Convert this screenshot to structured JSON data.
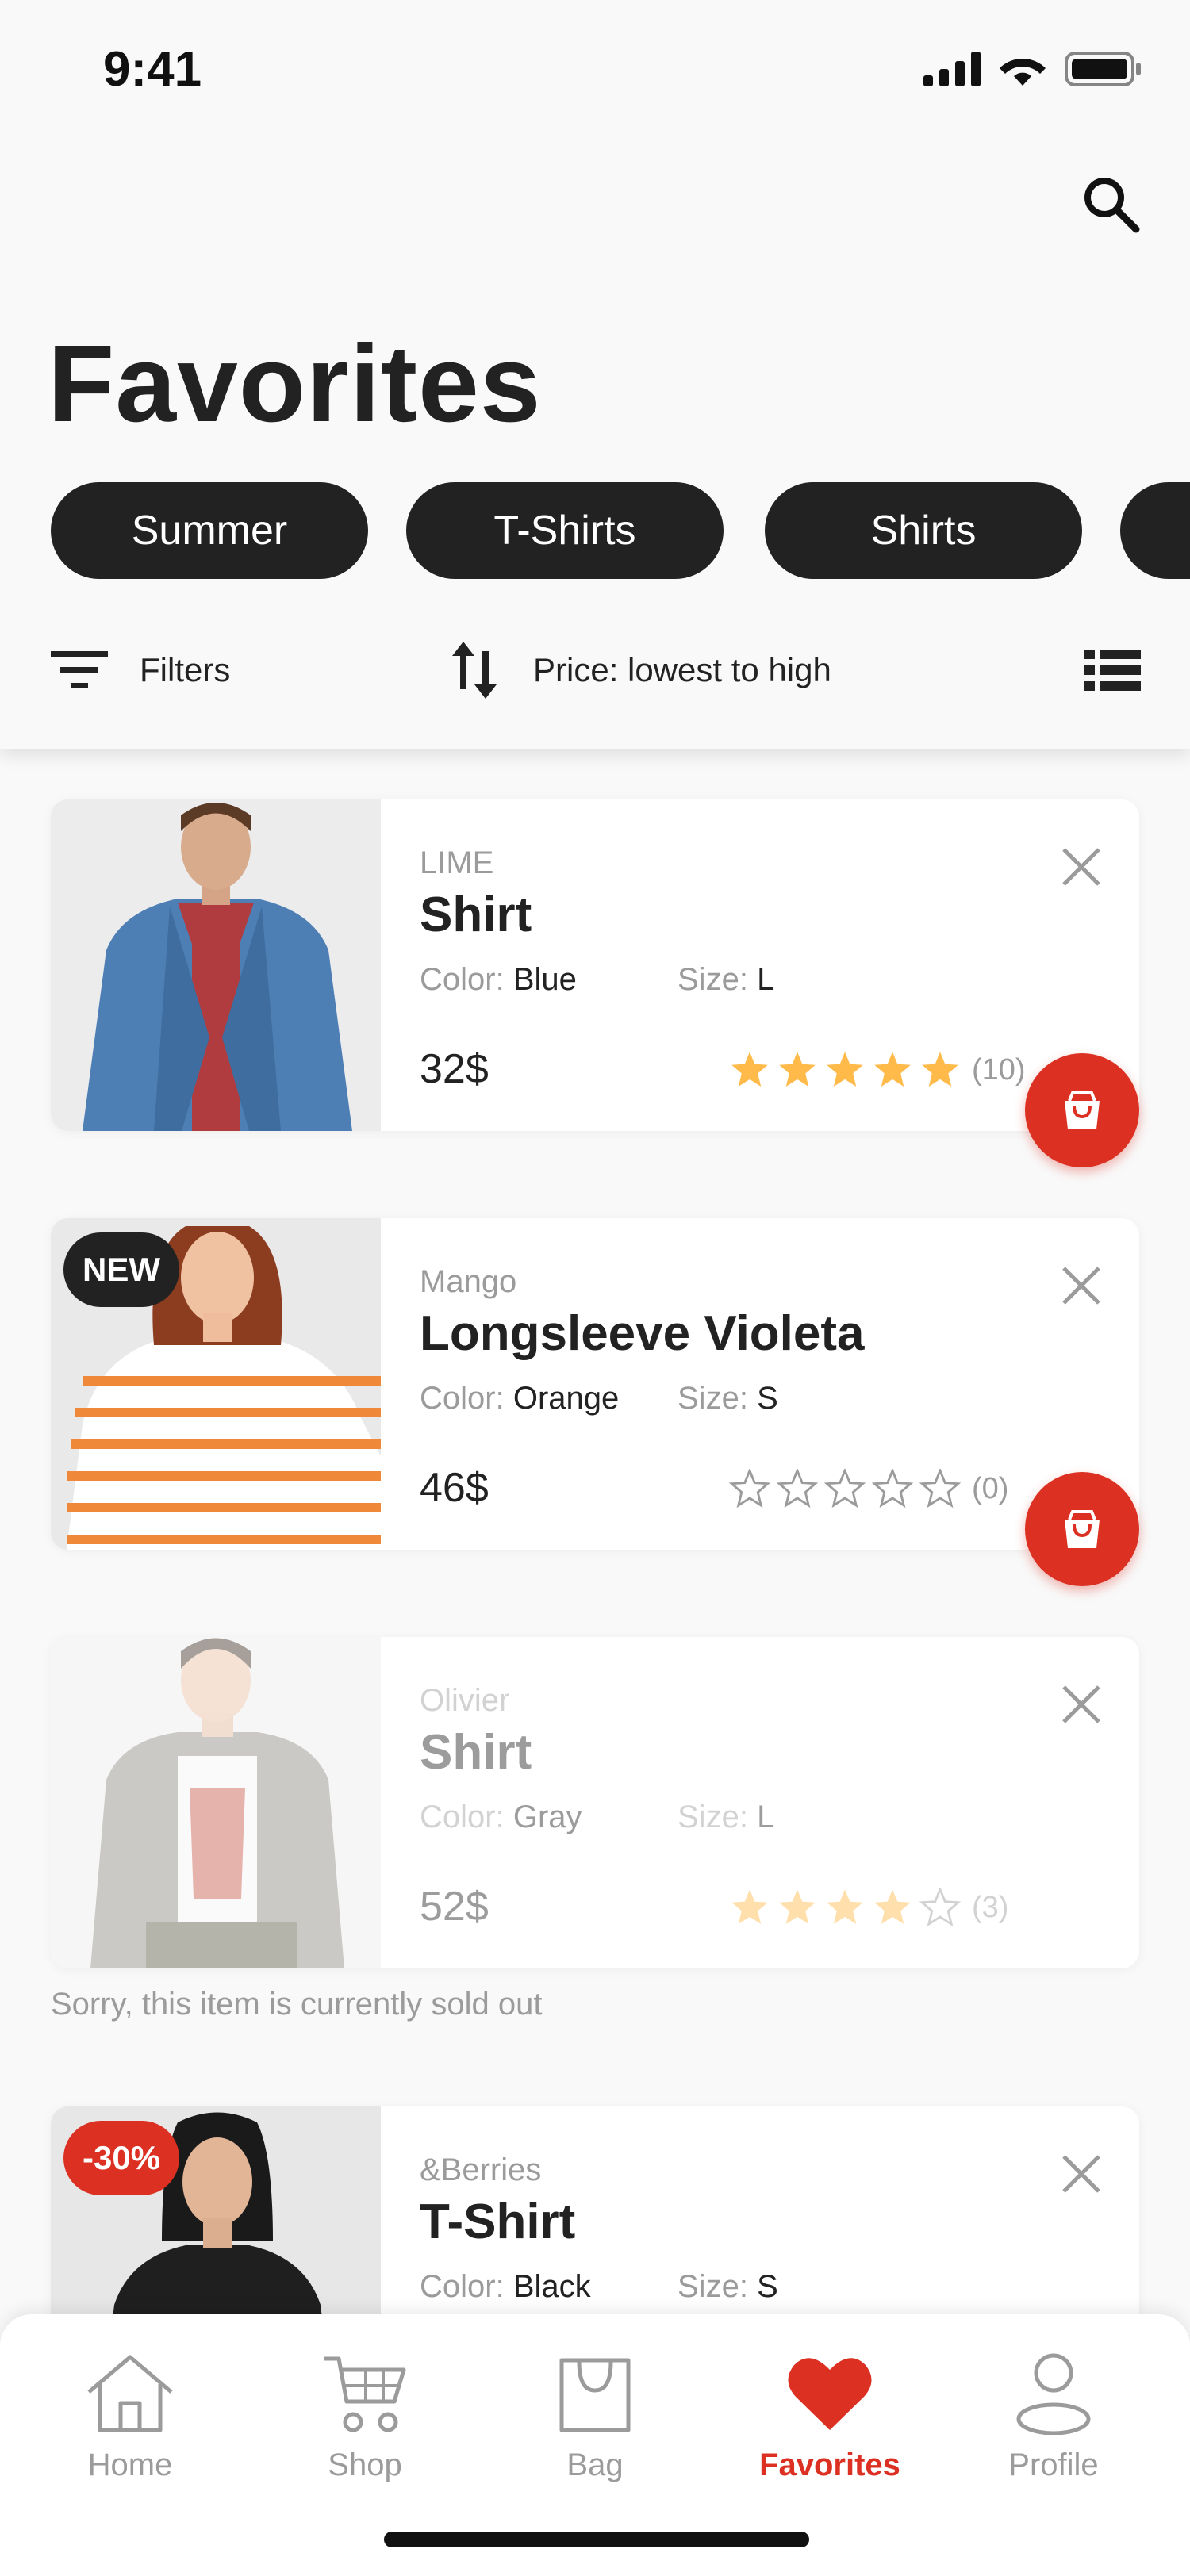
{
  "status_bar": {
    "time": "9:41"
  },
  "header": {
    "title": "Favorites"
  },
  "chips": [
    {
      "label": "Summer"
    },
    {
      "label": "T-Shirts"
    },
    {
      "label": "Shirts"
    },
    {
      "label": ""
    }
  ],
  "toolbar": {
    "filters_label": "Filters",
    "sort_label": "Price: lowest to high"
  },
  "colors": {
    "accent": "#DB3022",
    "dark": "#222222",
    "muted": "#9B9B9B",
    "star": "#FFBA49",
    "background": "#F9F9F9"
  },
  "labels": {
    "color_key": "Color:",
    "size_key": "Size:"
  },
  "products": [
    {
      "brand": "LIME",
      "name": "Shirt",
      "color": "Blue",
      "size": "L",
      "price": "32$",
      "rating": 5,
      "reviews": "(10)",
      "badge": "",
      "sold_out": false
    },
    {
      "brand": "Mango",
      "name": "Longsleeve Violeta",
      "color": "Orange",
      "size": "S",
      "price": "46$",
      "rating": 0,
      "reviews": "(0)",
      "badge": "NEW",
      "sold_out": false
    },
    {
      "brand": "Olivier",
      "name": "Shirt",
      "color": "Gray",
      "size": "L",
      "price": "52$",
      "rating": 4,
      "reviews": "(3)",
      "badge": "",
      "sold_out": true
    },
    {
      "brand": "&Berries",
      "name": "T-Shirt",
      "color": "Black",
      "size": "S",
      "price": "",
      "rating": null,
      "reviews": "",
      "badge": "-30%",
      "sold_out": false
    }
  ],
  "sold_out_message": "Sorry, this item is currently sold out",
  "bottom_nav": [
    {
      "label": "Home",
      "icon": "home-icon",
      "active": false
    },
    {
      "label": "Shop",
      "icon": "cart-icon",
      "active": false
    },
    {
      "label": "Bag",
      "icon": "bag-icon",
      "active": false
    },
    {
      "label": "Favorites",
      "icon": "heart-icon",
      "active": true
    },
    {
      "label": "Profile",
      "icon": "profile-icon",
      "active": false
    }
  ]
}
